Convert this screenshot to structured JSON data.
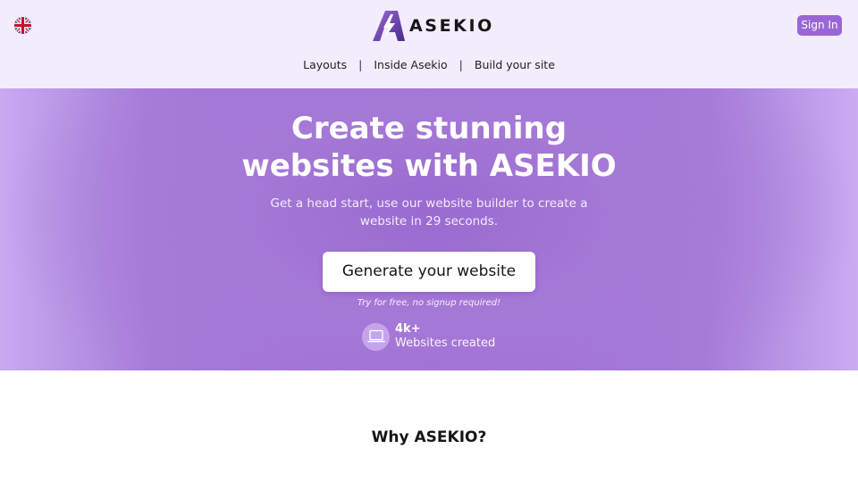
{
  "header": {
    "language_icon": "uk-flag-icon",
    "logo_text": "ASEKIO",
    "signin_label": "Sign In",
    "nav": {
      "items": [
        "Layouts",
        "Inside Asekio",
        "Build your site"
      ],
      "separator": "|"
    }
  },
  "hero": {
    "title_line1": "Create stunning",
    "title_line2": "websites with ASEKIO",
    "subtitle_line1": "Get a head start, use our website builder to create a",
    "subtitle_line2": "website in 29 seconds.",
    "cta_label": "Generate your website",
    "cta_note": "Try for free, no signup required!",
    "stat": {
      "icon": "laptop-icon",
      "count": "4k+",
      "label": "Websites created"
    }
  },
  "section": {
    "why_title": "Why ASEKIO?"
  },
  "colors": {
    "header_bg": "#f3ecfd",
    "brand_purple": "#9a66d4",
    "hero_purple": "#9c6dd2"
  }
}
